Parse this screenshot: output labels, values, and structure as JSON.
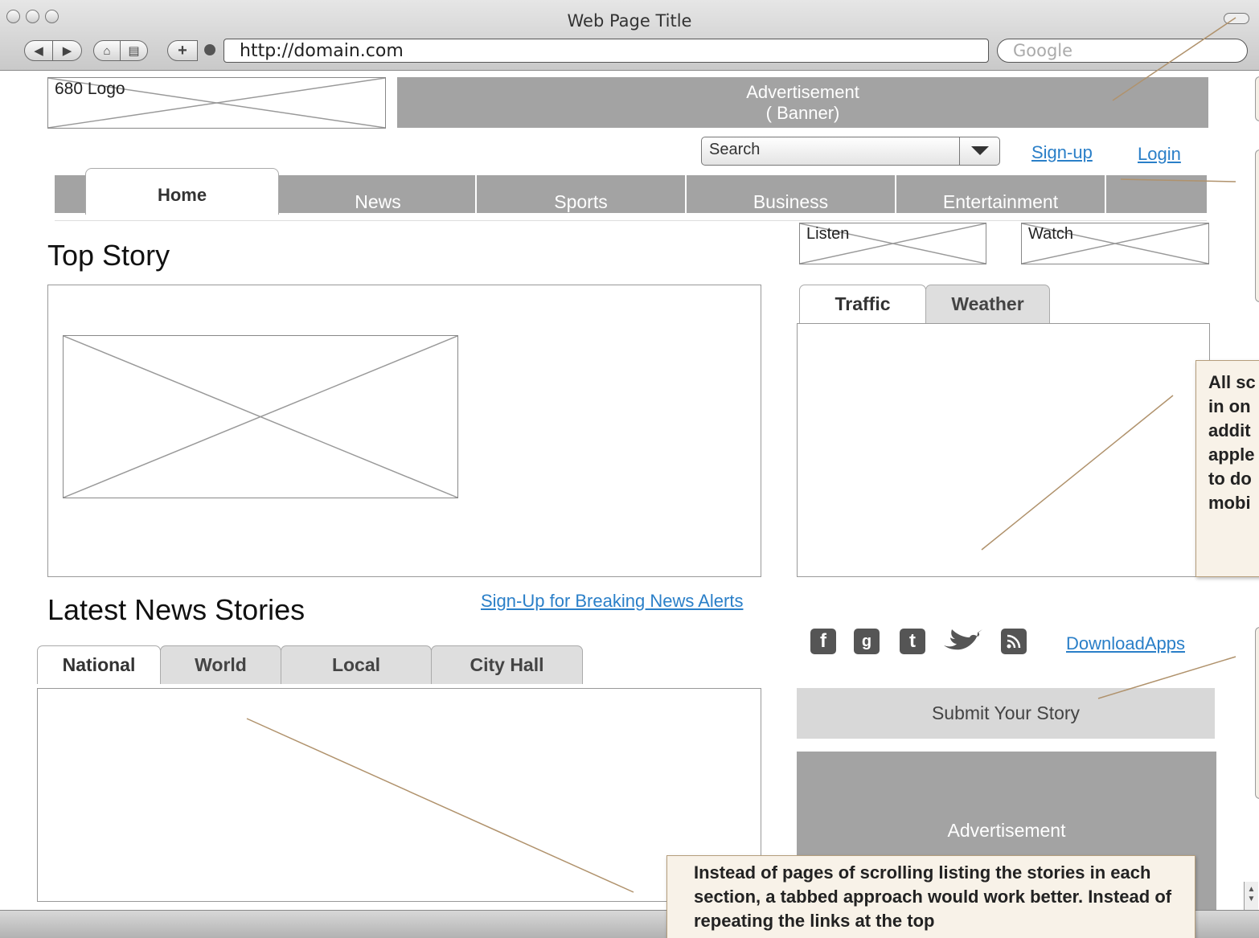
{
  "browser": {
    "window_title": "Web Page Title",
    "url": "http://domain.com",
    "search_placeholder": "Google"
  },
  "header": {
    "logo_label": "680 Logo",
    "banner_line1": "Advertisement",
    "banner_line2": "( Banner)",
    "search_label": "Search",
    "signup_label": "Sign-up",
    "login_label": "Login"
  },
  "nav": {
    "tabs": [
      "Home",
      "News",
      "Sports",
      "Business",
      "Entertainment"
    ],
    "active": "Home"
  },
  "top_story": {
    "heading": "Top Story"
  },
  "media": {
    "listen_label": "Listen",
    "watch_label": "Watch"
  },
  "info_tabs": {
    "tabs": [
      "Traffic",
      "Weather"
    ],
    "active": "Traffic"
  },
  "latest": {
    "heading": "Latest News Stories",
    "alerts_link": "Sign-Up for Breaking News Alerts",
    "tabs": [
      "National",
      "World",
      "Local",
      "City Hall"
    ],
    "active": "National"
  },
  "social": {
    "icons": [
      "facebook-icon",
      "google-plus-icon",
      "tumblr-icon",
      "twitter-icon",
      "rss-icon"
    ],
    "download_label": "DownloadApps"
  },
  "sidebar": {
    "submit_label": "Submit Your Story",
    "ad_label": "Advertisement"
  },
  "notes": {
    "right_note": "All sc in on addit apple to do mobi",
    "bottom_note": "Instead of pages of scrolling listing the stories in each section, a tabbed approach would work better. Instead of repeating the links at the top"
  },
  "colors": {
    "placeholder_gray": "#a3a3a3",
    "link_blue": "#2a7fc8",
    "note_bg": "#f8f2e8",
    "connector_brown": "#b0926c"
  }
}
